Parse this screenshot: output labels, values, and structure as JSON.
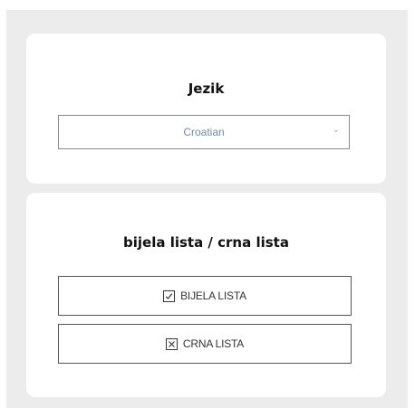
{
  "language_card": {
    "title": "Jezik",
    "selected_language": "Croatian",
    "chevron_icon": "chevron-down-icon"
  },
  "list_card": {
    "title": "bijela lista / crna lista",
    "whitelist_button": {
      "label": "BIJELA LISTA",
      "icon": "checkbox-checked-icon"
    },
    "blacklist_button": {
      "label": "CRNA LISTA",
      "icon": "checkbox-x-icon"
    }
  }
}
